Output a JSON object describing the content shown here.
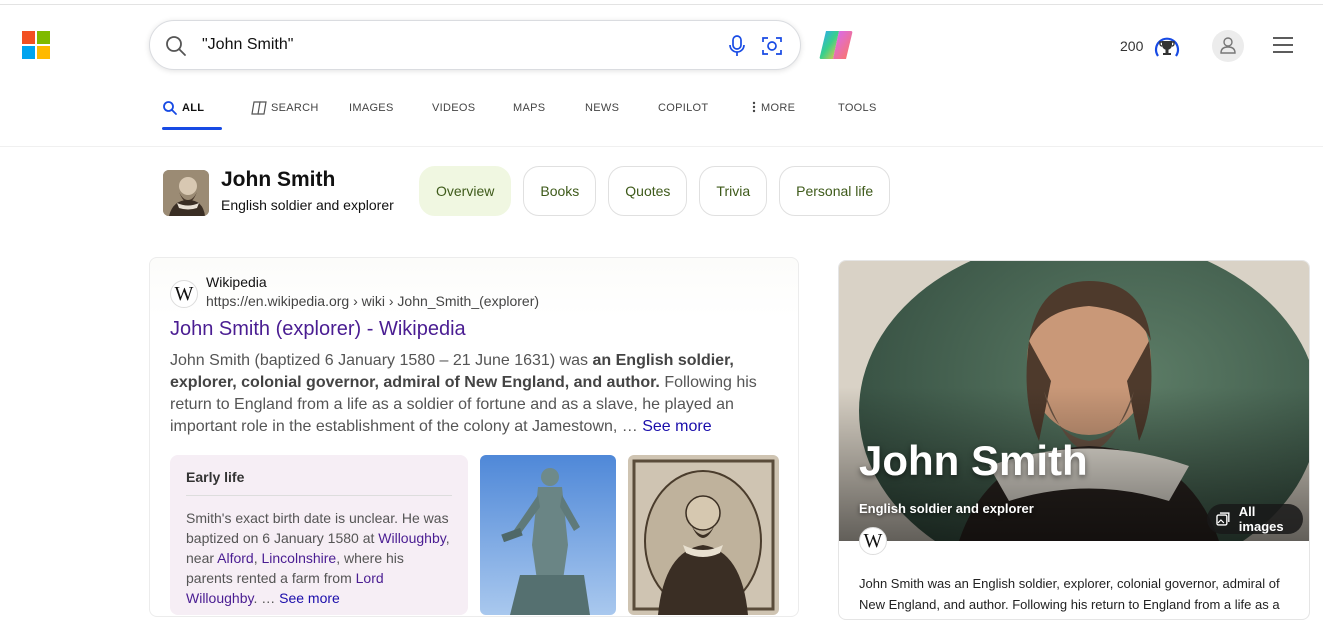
{
  "search": {
    "query": "\"John Smith\""
  },
  "header": {
    "points": "200"
  },
  "tabs": [
    {
      "label": "ALL"
    },
    {
      "label": "SEARCH"
    },
    {
      "label": "IMAGES"
    },
    {
      "label": "VIDEOS"
    },
    {
      "label": "MAPS"
    },
    {
      "label": "NEWS"
    },
    {
      "label": "COPILOT"
    },
    {
      "label": "MORE"
    },
    {
      "label": "TOOLS"
    }
  ],
  "entity": {
    "name": "John Smith",
    "description": "English soldier and explorer",
    "pills": [
      "Overview",
      "Books",
      "Quotes",
      "Trivia",
      "Personal life"
    ]
  },
  "result": {
    "source_name": "Wikipedia",
    "url": "https://en.wikipedia.org › wiki › John_Smith_(explorer)",
    "title": "John Smith (explorer) - Wikipedia",
    "snippet_start": "John Smith (baptized 6 January 1580 – 21 June 1631) was ",
    "snippet_bold": "an English soldier, explorer, colonial governor, admiral of New England, and author.",
    "snippet_end": " Following his return to England from a life as a soldier of fortune and as a slave, he played an important role in the establishment of the colony at Jamestown, … ",
    "see_more": "See more",
    "early_life": {
      "title": "Early life",
      "t1": "Smith's exact birth date is unclear. He was baptized on 6 January 1580 at ",
      "l1": "Willoughby",
      "t2": ", near ",
      "l2": "Alford",
      "t3": ", ",
      "l3": "Lincolnshire",
      "t4": ", where his parents rented a farm from ",
      "l4": "Lord Willoughby",
      "t5": ". … ",
      "see_more": "See more"
    }
  },
  "knowledge_panel": {
    "name": "John Smith",
    "description": "English soldier and explorer",
    "all_images": "All images",
    "text": "John Smith was an English soldier, explorer, colonial governor, admiral of New England, and author. Following his return to England from a life as a"
  },
  "colors": {
    "accent": "#174ae4",
    "link": "#4a1d92",
    "pill_active_bg": "#f0f7e1"
  }
}
